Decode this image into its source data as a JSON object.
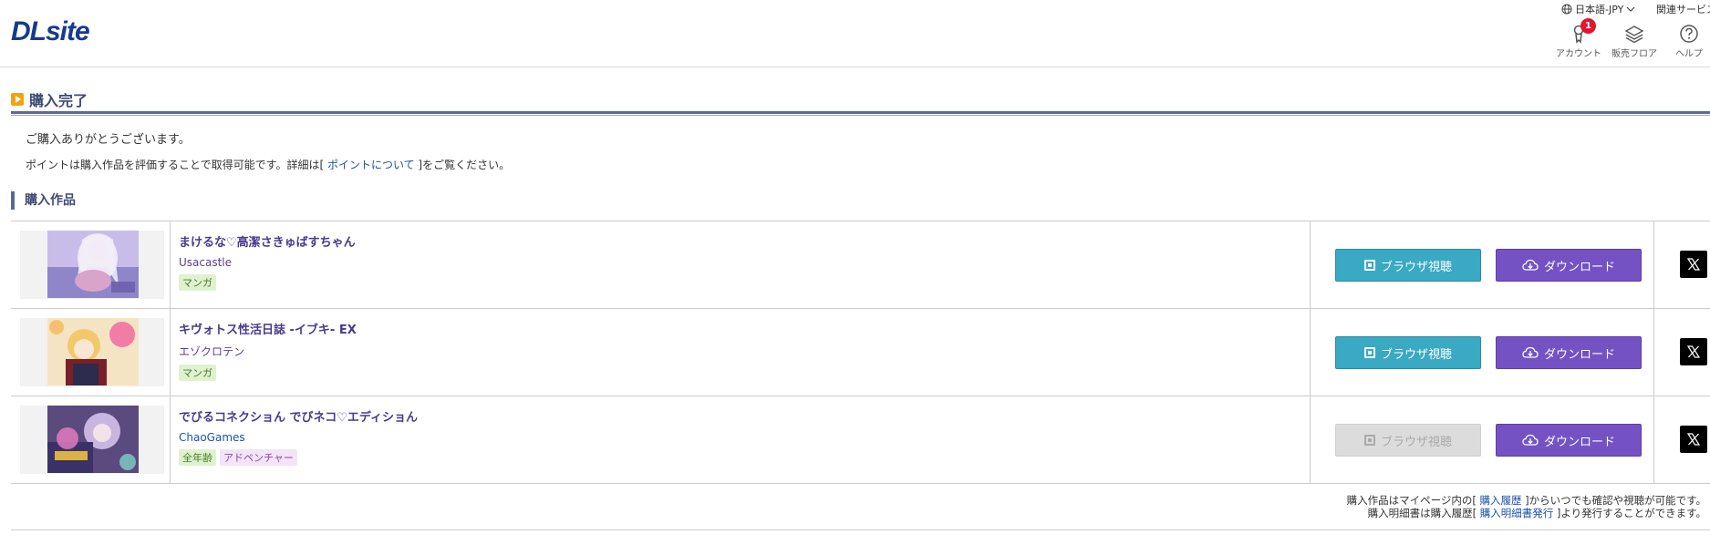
{
  "header": {
    "logo": "DLsite",
    "language": "日本語-JPY",
    "related": "関連サービス",
    "account_label": "アカウント",
    "account_badge": "1",
    "floor_label": "販売フロア",
    "help_label": "ヘルプ"
  },
  "page": {
    "title": "購入完了",
    "thanks": "ご購入ありがとうございます。",
    "points_prefix": "ポイントは購入作品を評価することで取得可能です。詳細は[ ",
    "points_link": "ポイントについて",
    "points_suffix": " ]をご覧ください。",
    "section_title": "購入作品"
  },
  "items": [
    {
      "title": "まけるな♡高潔さきゅばすちゃん",
      "maker": "Usacastle",
      "tags": [
        "マンガ"
      ],
      "browser_label": "ブラウザ視聴",
      "download_label": "ダウンロード"
    },
    {
      "title": "キヴォトス性活日誌 -イブキ- EX",
      "maker": "エゾクロテン",
      "tags": [
        "マンガ"
      ],
      "browser_label": "ブラウザ視聴",
      "download_label": "ダウンロード"
    },
    {
      "title": "でびるコネクショん でびネコ♡エディショん",
      "maker": "ChaoGames",
      "tags": [
        "全年齢",
        "アドベンチャー"
      ],
      "browser_label": "ブラウザ視聴",
      "browser_disabled": true,
      "download_label": "ダウンロード"
    }
  ],
  "footer": {
    "line1_prefix": "購入作品はマイページ内の[ ",
    "line1_link": "購入履歴",
    "line1_suffix": " ]からいつでも確認や視聴が可能です。",
    "line2_prefix": "購入明細書は購入履歴[ ",
    "line2_link": "購入明細書発行",
    "line2_suffix": " ]より発行することができます。"
  },
  "colors": {
    "browser_button": "#39a9c4",
    "download_button": "#7452c4",
    "title_accent": "#3d4a78",
    "badge": "#e2162f"
  }
}
